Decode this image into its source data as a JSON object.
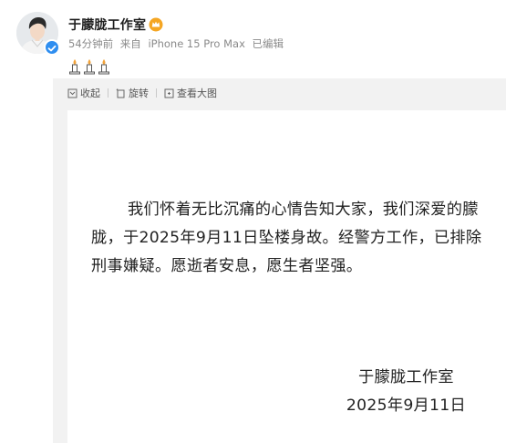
{
  "post": {
    "author": {
      "name": "于朦胧工作室",
      "verified": true
    },
    "meta": {
      "time": "54分钟前",
      "source_prefix": "来自",
      "device": "iPhone 15 Pro Max",
      "edited": "已编辑"
    },
    "emoji": [
      "candle-icon",
      "candle-icon",
      "candle-icon"
    ]
  },
  "image_toolbar": {
    "collect_label": "收起",
    "rotate_label": "旋转",
    "view_large_label": "查看大图"
  },
  "image": {
    "statement": "我们怀着无比沉痛的心情告知大家，我们深爱的朦胧，于2025年9月11日坠楼身故。经警方工作，已排除刑事嫌疑。愿逝者安息，愿生者坚强。",
    "signature_name": "于朦胧工作室",
    "signature_date": "2025年9月11日"
  },
  "colors": {
    "panel_bg": "#f2f2f2",
    "verified_blue": "#2f8ef0",
    "vip_orange": "#f5a623"
  }
}
